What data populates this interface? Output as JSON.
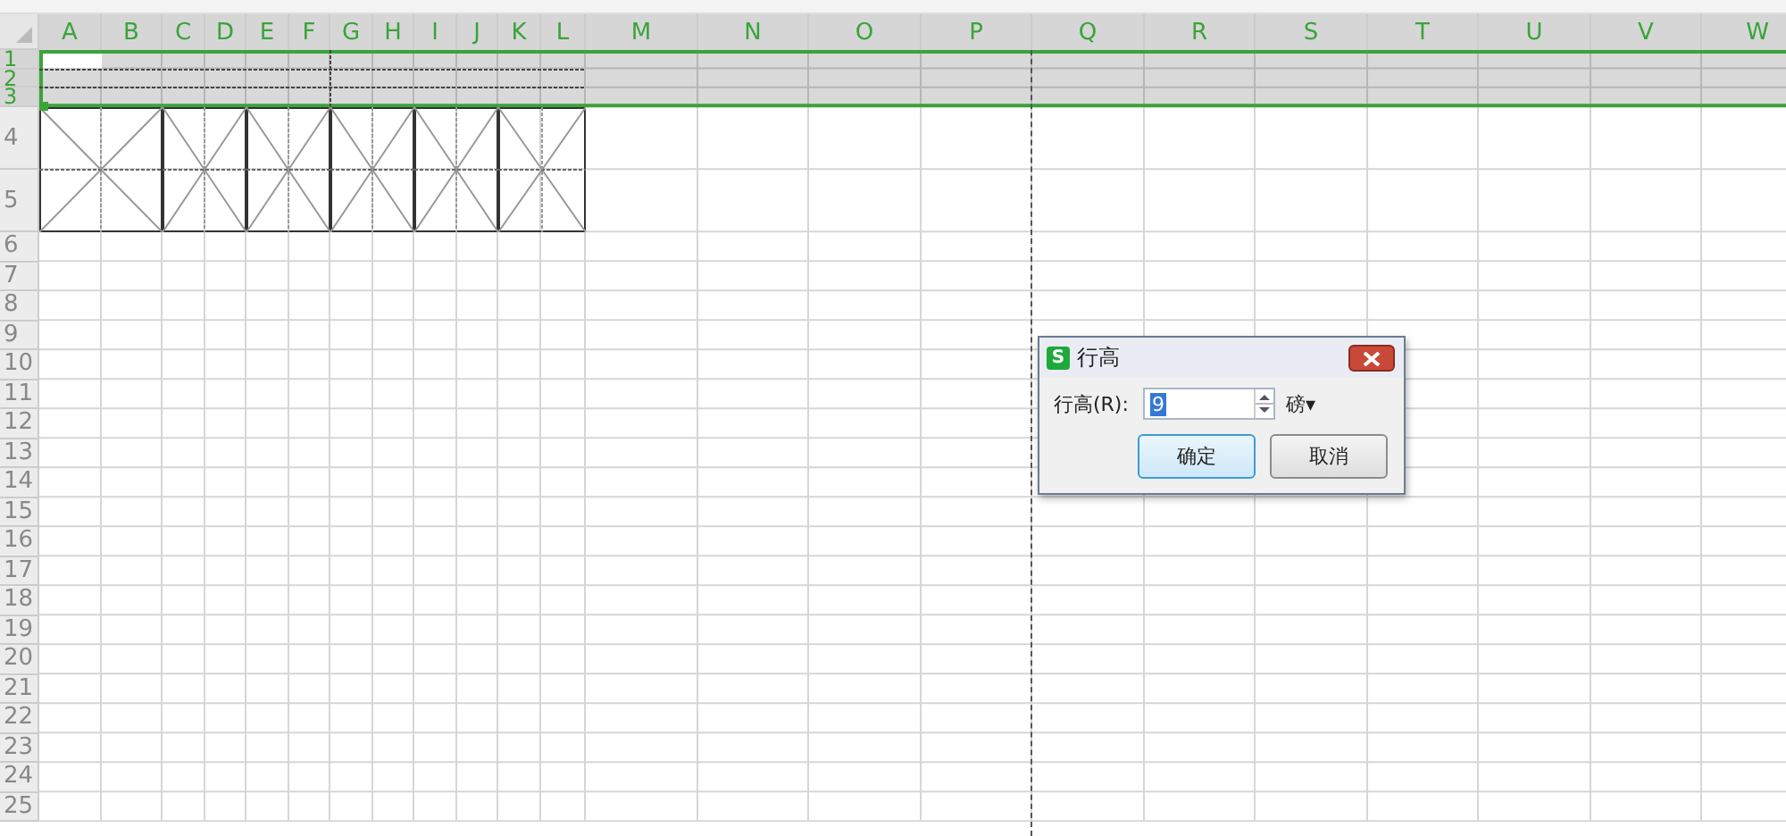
{
  "columns": [
    {
      "label": "A",
      "highlighted": true
    },
    {
      "label": "B",
      "highlighted": true
    },
    {
      "label": "C",
      "highlighted": true
    },
    {
      "label": "D",
      "highlighted": true
    },
    {
      "label": "E",
      "highlighted": true
    },
    {
      "label": "F",
      "highlighted": true
    },
    {
      "label": "G",
      "highlighted": true
    },
    {
      "label": "H",
      "highlighted": true
    },
    {
      "label": "I",
      "highlighted": true
    },
    {
      "label": "J",
      "highlighted": true
    },
    {
      "label": "K",
      "highlighted": true
    },
    {
      "label": "L",
      "highlighted": true
    },
    {
      "label": "M",
      "highlighted": true
    },
    {
      "label": "N",
      "highlighted": true
    },
    {
      "label": "O",
      "highlighted": true
    },
    {
      "label": "P",
      "highlighted": true
    },
    {
      "label": "Q",
      "highlighted": true
    },
    {
      "label": "R",
      "highlighted": true
    },
    {
      "label": "S",
      "highlighted": true
    },
    {
      "label": "T",
      "highlighted": true
    },
    {
      "label": "U",
      "highlighted": true
    },
    {
      "label": "V",
      "highlighted": true
    },
    {
      "label": "W",
      "highlighted": true
    }
  ],
  "rows": [
    {
      "label": "1",
      "selected": true
    },
    {
      "label": "2",
      "selected": true
    },
    {
      "label": "3",
      "selected": true
    },
    {
      "label": "4",
      "selected": false
    },
    {
      "label": "5",
      "selected": false
    },
    {
      "label": "6",
      "selected": false
    },
    {
      "label": "7",
      "selected": false
    },
    {
      "label": "8",
      "selected": false
    },
    {
      "label": "9",
      "selected": false
    },
    {
      "label": "10",
      "selected": false
    },
    {
      "label": "11",
      "selected": false
    },
    {
      "label": "12",
      "selected": false
    },
    {
      "label": "13",
      "selected": false
    },
    {
      "label": "14",
      "selected": false
    },
    {
      "label": "15",
      "selected": false
    },
    {
      "label": "16",
      "selected": false
    },
    {
      "label": "17",
      "selected": false
    },
    {
      "label": "18",
      "selected": false
    },
    {
      "label": "19",
      "selected": false
    },
    {
      "label": "20",
      "selected": false
    },
    {
      "label": "21",
      "selected": false
    },
    {
      "label": "22",
      "selected": false
    },
    {
      "label": "23",
      "selected": false
    },
    {
      "label": "24",
      "selected": false
    },
    {
      "label": "25",
      "selected": false
    }
  ],
  "dialog": {
    "icon_letter": "S",
    "title": "行高",
    "field_label": "行高(R):",
    "value": "9",
    "unit": "磅",
    "unit_caret": "▾",
    "buttons": [
      {
        "label": "确定",
        "selected": true
      },
      {
        "label": "取消",
        "selected": false
      }
    ]
  }
}
